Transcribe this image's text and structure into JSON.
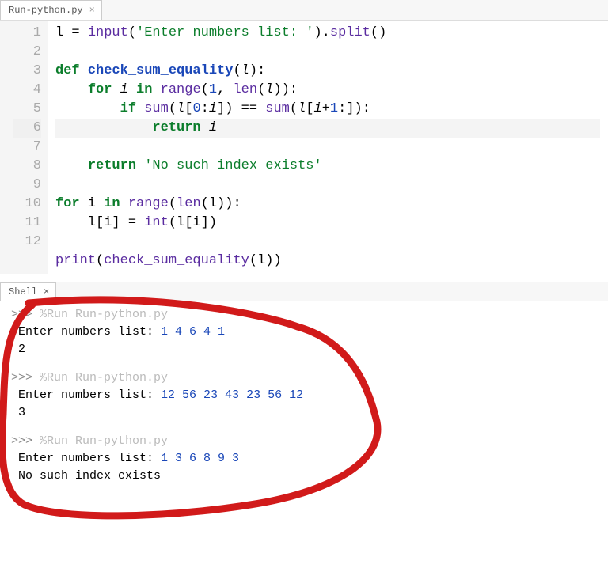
{
  "editor": {
    "tab": "Run-python.py",
    "close_glyph": "×",
    "line_numbers": [
      "1",
      "2",
      "3",
      "4",
      "5",
      "6",
      "7",
      "8",
      "9",
      "10",
      "11",
      "12"
    ]
  },
  "code": {
    "l1_var": "l",
    "l1_assign": " = ",
    "l1_input": "input",
    "l1_open": "(",
    "l1_str": "'Enter numbers list: '",
    "l1_close": ")",
    "l1_dot": ".",
    "l1_split": "split",
    "l1_tail": "()",
    "l3_def": "def",
    "l3_name": " check_sum_equality",
    "l3_sig_open": "(",
    "l3_param": "l",
    "l3_sig_close": "):",
    "l4_for": "for",
    "l4_i": " i ",
    "l4_in": "in",
    "l4_range": " range",
    "l4_args_open": "(",
    "l4_one": "1",
    "l4_comma": ", ",
    "l4_len": "len",
    "l4_len_open": "(",
    "l4_len_arg": "l",
    "l4_len_close": ")",
    "l4_args_close": "):",
    "l5_if": "if",
    "l5_sum1": " sum",
    "l5_s1_open": "(",
    "l5_s1_arg": "l",
    "l5_s1_sl_open": "[",
    "l5_s1_zero": "0",
    "l5_s1_colon": ":",
    "l5_s1_i": "i",
    "l5_s1_sl_close": "]",
    "l5_s1_close": ")",
    "l5_eq": " == ",
    "l5_sum2": "sum",
    "l5_s2_open": "(",
    "l5_s2_arg": "l",
    "l5_s2_sl_open": "[",
    "l5_s2_i": "i",
    "l5_s2_plus": "+",
    "l5_s2_one": "1",
    "l5_s2_colon": ":",
    "l5_s2_sl_close": "]",
    "l5_s2_close": "):",
    "l6_return": "return",
    "l6_i": " i",
    "l7_return": "return",
    "l7_str": " 'No such index exists'",
    "l9_for": "for",
    "l9_i": " i ",
    "l9_in": "in",
    "l9_range": " range",
    "l9_args_open": "(",
    "l9_len": "len",
    "l9_len_open": "(",
    "l9_len_arg": "l",
    "l9_len_close": ")",
    "l9_args_close": "):",
    "l10_body_a": "    l[i] = ",
    "l10_int": "int",
    "l10_body_b": "(l[i])",
    "l12_print": "print",
    "l12_open": "(",
    "l12_call": "check_sum_equality",
    "l12_arg_open": "(",
    "l12_arg": "l",
    "l12_arg_close": ")",
    "l12_close": ")"
  },
  "shell": {
    "tab": "Shell",
    "close_glyph": "×",
    "prompt": ">>>",
    "run_cmd": " %Run Run-python.py",
    "input_label": "Enter numbers list: ",
    "runs": [
      {
        "input": "1 4 6 4 1",
        "output": "2"
      },
      {
        "input": "12 56 23 43 23 56 12",
        "output": "3"
      },
      {
        "input": "1 3 6 8 9 3",
        "output": "No such index exists"
      }
    ]
  },
  "annotation": {
    "stroke": "#d11a1a",
    "stroke_width": 9
  }
}
